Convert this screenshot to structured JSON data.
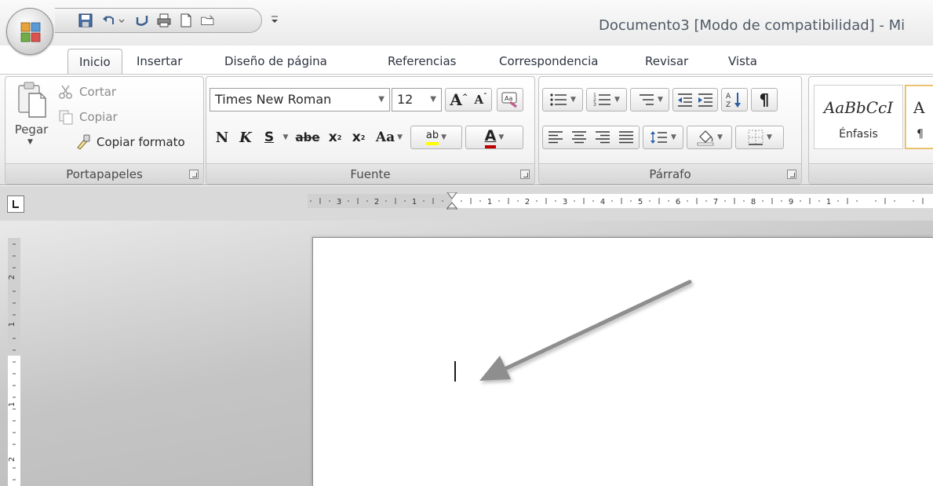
{
  "window": {
    "title": "Documento3 [Modo de compatibilidad] - Mi"
  },
  "tabs": [
    {
      "label": "Inicio",
      "active": true
    },
    {
      "label": "Insertar"
    },
    {
      "label": "Diseño de página"
    },
    {
      "label": "Referencias"
    },
    {
      "label": "Correspondencia"
    },
    {
      "label": "Revisar"
    },
    {
      "label": "Vista"
    }
  ],
  "clipboard": {
    "paste_label": "Pegar",
    "cut_label": "Cortar",
    "copy_label": "Copiar",
    "format_painter_label": "Copiar formato",
    "group_label": "Portapapeles"
  },
  "font": {
    "family": "Times New Roman",
    "size": "12",
    "grow_label": "A",
    "shrink_label": "A",
    "bold_label": "N",
    "italic_label": "K",
    "underline_label": "S",
    "strike_label": "abe",
    "subscript_label": "x",
    "superscript_label": "x",
    "change_case_label": "Aa",
    "highlight_label": "ab",
    "font_color_label": "A",
    "group_label": "Fuente"
  },
  "paragraph": {
    "group_label": "Párrafo"
  },
  "styles": {
    "items": [
      {
        "sample": "AaBbCcI",
        "name": "Énfasis"
      },
      {
        "sample": "A",
        "name": "¶"
      }
    ]
  },
  "ruler": {
    "labels": [
      "3",
      "2",
      "1",
      "1",
      "2",
      "3",
      "4",
      "5",
      "6",
      "7",
      "8",
      "9",
      "1"
    ],
    "vertical_labels": [
      "2",
      "1",
      "1",
      "2"
    ]
  },
  "colors": {
    "arrow": "#8e8e8e",
    "font_color_bar": "#c00000",
    "highlight_bar": "#ffff00",
    "accent_tab_text": "#2d3340"
  }
}
